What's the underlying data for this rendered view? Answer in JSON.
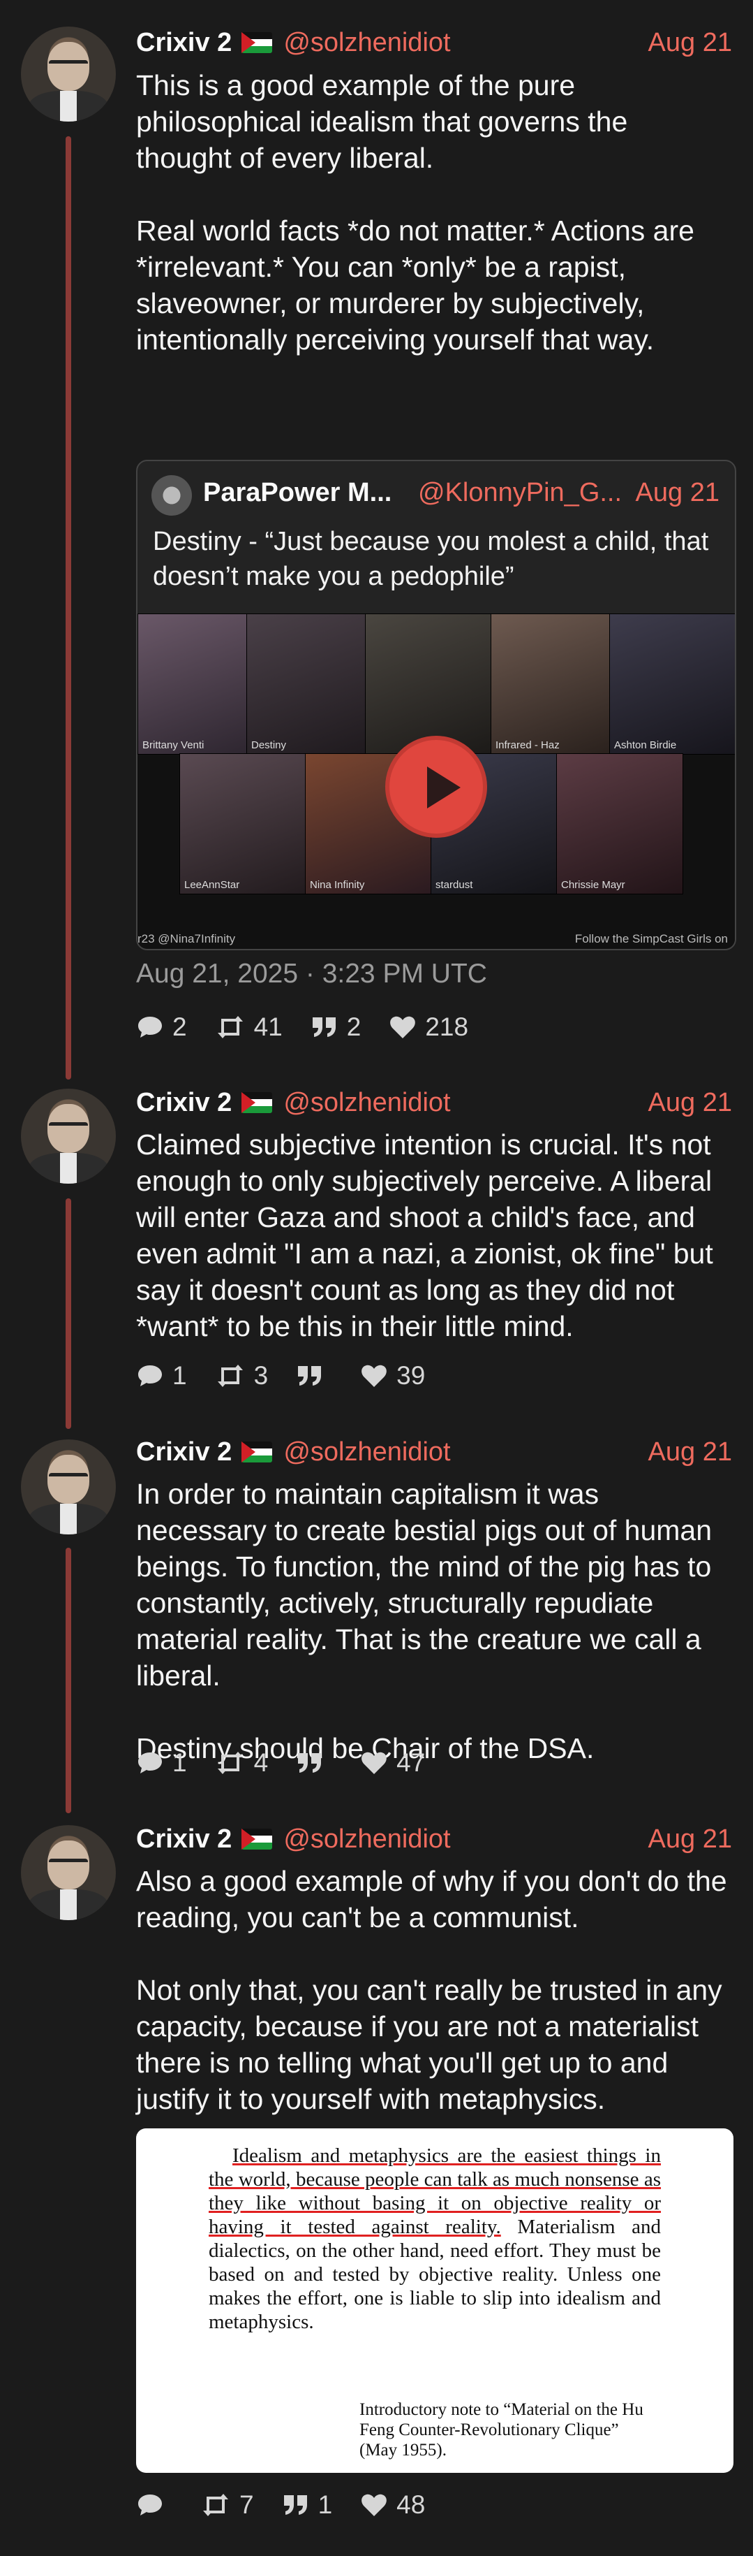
{
  "posts": [
    {
      "name": "Crixiv 2",
      "handle": "@solzhenidiot",
      "date": "Aug 21",
      "text": [
        "This is a good example of the pure philosophical idealism that governs the thought of every liberal.",
        "Real world facts *do not matter.* Actions are *irrelevant.* You can *only* be a rapist, slaveowner, or murderer by subjectively, intentionally perceiving yourself that way."
      ],
      "quote": {
        "name": "ParaPower M...",
        "handle": "@KlonnyPin_G...",
        "date": "Aug 21",
        "text": "Destiny - “Just because you molest a child, that doesn’t make you a pedophile”",
        "video_labels": [
          "Brittany Venti",
          "Destiny",
          "Infrared - Haz",
          "Ashton Birdie",
          "LeeAnnStar",
          "Nina Infinity",
          "stardust",
          "Chrissie Mayr"
        ],
        "video_caption_left": "r23 @Nina7Infinity",
        "video_caption_right": "Follow the SimpCast Girls on"
      },
      "timestamp": "Aug 21, 2025 · 3:23 PM UTC",
      "stats": {
        "replies": "2",
        "reposts": "41",
        "quotes": "2",
        "likes": "218"
      }
    },
    {
      "name": "Crixiv 2",
      "handle": "@solzhenidiot",
      "date": "Aug 21",
      "text": [
        "Claimed subjective intention is crucial. It's not enough to only subjectively perceive. A liberal will enter Gaza and shoot a child's face, and even admit \"I am a nazi, a zionist, ok fine\" but say it doesn't count as long as they did not *want* to be this in their little mind."
      ],
      "stats": {
        "replies": "1",
        "reposts": "3",
        "quotes": "",
        "likes": "39"
      }
    },
    {
      "name": "Crixiv 2",
      "handle": "@solzhenidiot",
      "date": "Aug 21",
      "text": [
        "In order to maintain capitalism it was necessary to create bestial pigs out of human beings. To function, the mind of the pig has to constantly, actively, structurally repudiate material reality. That is the creature we call a liberal.",
        "Destiny should be Chair of the DSA."
      ],
      "stats": {
        "replies": "1",
        "reposts": "4",
        "quotes": "",
        "likes": "47"
      }
    },
    {
      "name": "Crixiv 2",
      "handle": "@solzhenidiot",
      "date": "Aug 21",
      "text": [
        "Also a good example of why if you don't do the reading, you can't be a communist.",
        "Not only that, you can't really be trusted in any capacity, because if you are not a materialist there is no telling what you'll get up to and justify it to yourself with metaphysics."
      ],
      "image_text": {
        "underlined": "Idealism and metaphysics are the easiest things in the world, because people can talk as much nonsense as they like without basing it on objective reality or having it tested against reality.",
        "rest": " Materialism and dialectics, on the other hand, need effort. They must be based on and tested by objective reality. Unless one makes the effort, one is liable to slip into idealism and metaphysics.",
        "citation": "Introductory note to “Material on the Hu Feng Counter-Revolutionary Clique” (May 1955)."
      },
      "stats": {
        "replies": "",
        "reposts": "7",
        "quotes": "1",
        "likes": "48"
      }
    }
  ],
  "colors": {
    "accent": "#ef6b5e",
    "thread": "#8b3a36",
    "background": "#1b1b1b"
  }
}
